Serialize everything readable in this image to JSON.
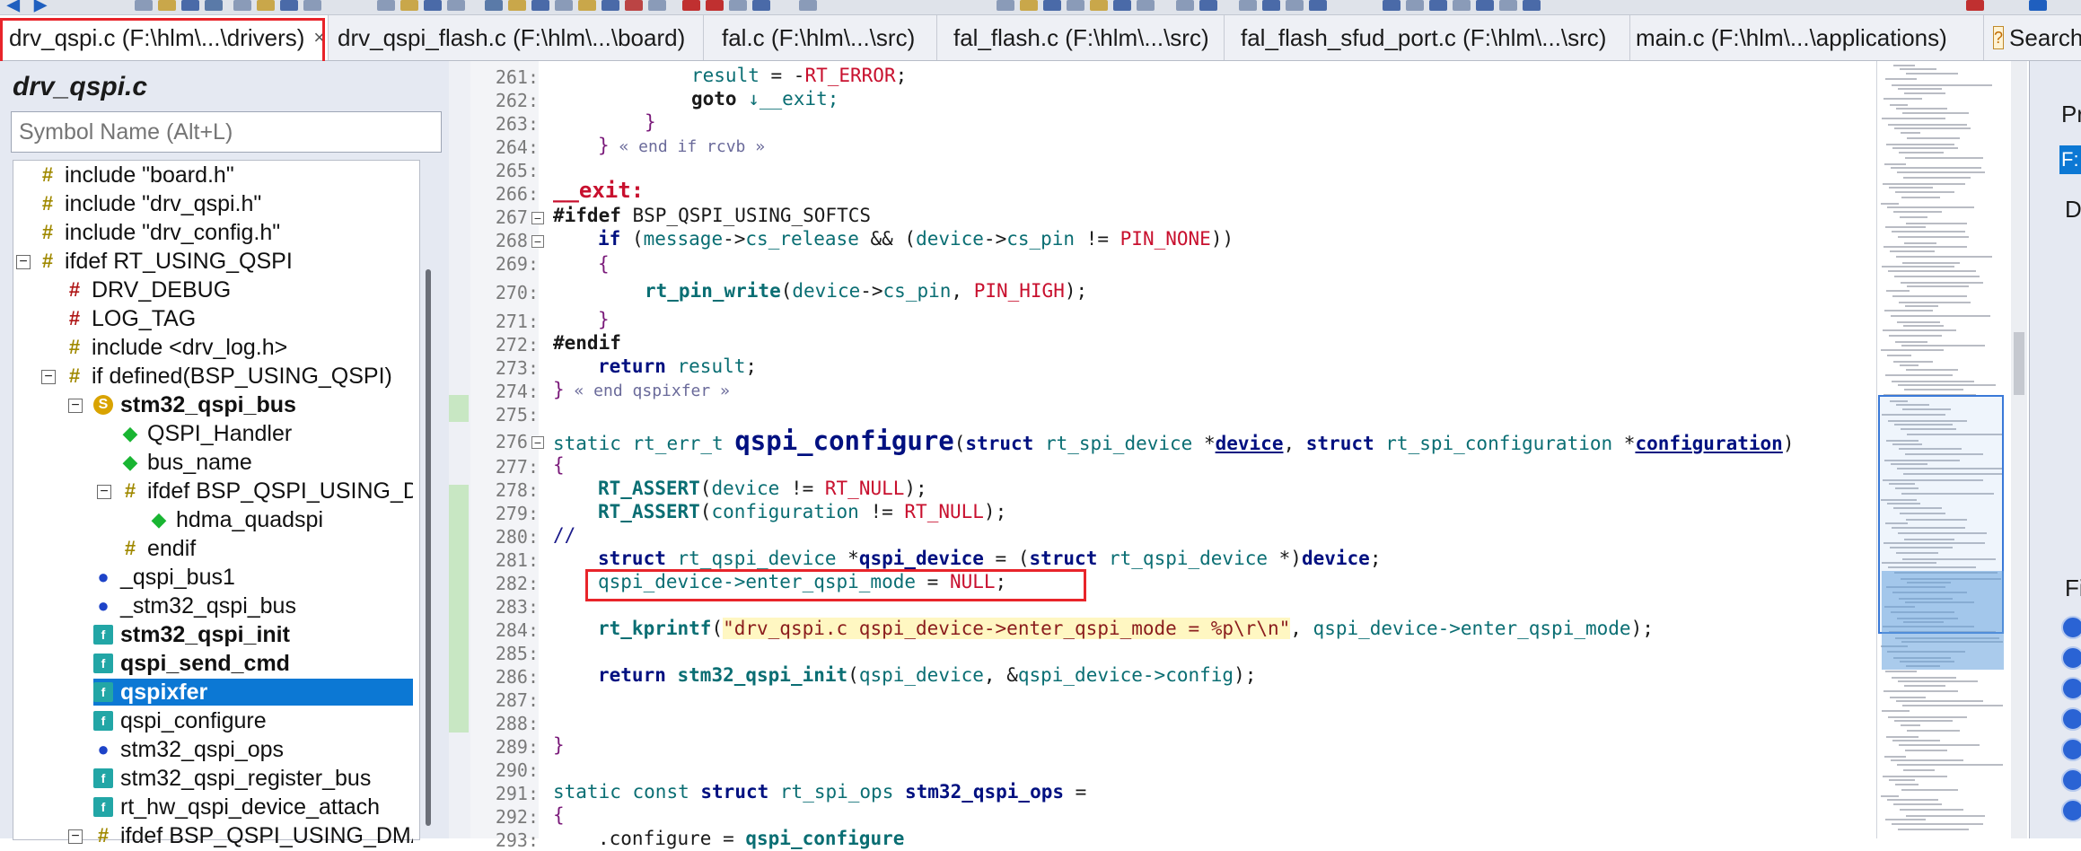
{
  "tabs": [
    {
      "label": "drv_qspi.c (F:\\hlm\\...\\drivers)",
      "close": "×",
      "active": true
    },
    {
      "label": "drv_qspi_flash.c (F:\\hlm\\...\\board)"
    },
    {
      "label": "fal.c (F:\\hlm\\...\\src)"
    },
    {
      "label": "fal_flash.c (F:\\hlm\\...\\src)"
    },
    {
      "label": "fal_flash_sfud_port.c (F:\\hlm\\...\\src)"
    },
    {
      "label": "main.c (F:\\hlm\\...\\applications)"
    },
    {
      "label": "Search"
    }
  ],
  "symbols_panel": {
    "file_title": "drv_qspi.c",
    "search_placeholder": "Symbol Name (Alt+L)",
    "items": [
      {
        "label": "include \"board.h\"",
        "icon": "hash-icon"
      },
      {
        "label": "include \"drv_qspi.h\"",
        "icon": "hash-icon"
      },
      {
        "label": "include \"drv_config.h\"",
        "icon": "hash-icon"
      },
      {
        "label": "ifdef RT_USING_QSPI",
        "icon": "hash-icon",
        "expander": "−"
      },
      {
        "label": "DRV_DEBUG",
        "icon": "red-hash-icon"
      },
      {
        "label": "LOG_TAG",
        "icon": "red-hash-icon"
      },
      {
        "label": "include <drv_log.h>",
        "icon": "hash-icon"
      },
      {
        "label": "if defined(BSP_USING_QSPI)",
        "icon": "hash-icon",
        "expander": "−"
      },
      {
        "label": "stm32_qspi_bus",
        "icon": "struct-icon",
        "expander": "−",
        "bold": true
      },
      {
        "label": "QSPI_Handler",
        "icon": "field-icon"
      },
      {
        "label": "bus_name",
        "icon": "field-icon"
      },
      {
        "label": "ifdef BSP_QSPI_USING_DMA",
        "icon": "hash-icon",
        "expander": "−"
      },
      {
        "label": "hdma_quadspi",
        "icon": "field-icon"
      },
      {
        "label": "endif",
        "icon": "hash-icon"
      },
      {
        "label": "_qspi_bus1",
        "icon": "variable-icon"
      },
      {
        "label": "_stm32_qspi_bus",
        "icon": "variable-icon"
      },
      {
        "label": "stm32_qspi_init",
        "icon": "function-icon",
        "bold": true
      },
      {
        "label": "qspi_send_cmd",
        "icon": "function-icon",
        "bold": true
      },
      {
        "label": "qspixfer",
        "icon": "function-icon",
        "bold": true,
        "selected": true
      },
      {
        "label": "qspi_configure",
        "icon": "function-icon"
      },
      {
        "label": "stm32_qspi_ops",
        "icon": "variable-icon"
      },
      {
        "label": "stm32_qspi_register_bus",
        "icon": "function-icon"
      },
      {
        "label": "rt_hw_qspi_device_attach",
        "icon": "function-icon"
      },
      {
        "label": "ifdef BSP_QSPI_USING_DMA",
        "icon": "hash-icon",
        "expander": "−"
      }
    ]
  },
  "editor": {
    "line_numbers": [
      "261:",
      "262:",
      "263:",
      "264:",
      "265:",
      "266:",
      "267:",
      "268:",
      "269:",
      "270:",
      "271:",
      "272:",
      "273:",
      "274:",
      "275:",
      "276:",
      "277:",
      "278:",
      "279:",
      "280:",
      "281:",
      "282:",
      "283:",
      "284:",
      "285:",
      "286:",
      "287:",
      "288:",
      "289:",
      "290:",
      "291:",
      "292:",
      "293:"
    ],
    "code": {
      "l261_a": "result",
      "l261_b": " = -",
      "l261_c": "RT_ERROR",
      "l261_d": ";",
      "l262_a": "goto",
      "l262_b": " ↓__exit;",
      "l263": "}",
      "l264_a": "}",
      "l264_b": " « end if rcvb »",
      "l266": "__exit:",
      "l267_a": "#ifdef",
      "l267_b": " BSP_QSPI_USING_SOFTCS",
      "l268_a": "if",
      "l268_b": " (",
      "l268_c": "message",
      "l268_d": "->",
      "l268_e": "cs_release",
      "l268_f": " && (",
      "l268_g": "device",
      "l268_h": "->",
      "l268_i": "cs_pin",
      "l268_j": " != ",
      "l268_k": "PIN_NONE",
      "l268_l": "))",
      "l269": "{",
      "l270_a": "rt_pin_write",
      "l270_b": "(",
      "l270_c": "device",
      "l270_d": "->",
      "l270_e": "cs_pin",
      "l270_f": ", ",
      "l270_g": "PIN_HIGH",
      "l270_h": ");",
      "l271": "}",
      "l272": "#endif",
      "l273_a": "return",
      "l273_b": " ",
      "l273_c": "result",
      "l273_d": ";",
      "l274_a": "}",
      "l274_b": " « end qspixfer »",
      "l276_a": "static",
      "l276_b": " ",
      "l276_c": "rt_err_t",
      "l276_d": " ",
      "l276_e": "qspi_configure",
      "l276_f": "(",
      "l276_g": "struct",
      "l276_h": " ",
      "l276_i": "rt_spi_device",
      "l276_j": " *",
      "l276_k": "device",
      "l276_l": ", ",
      "l276_m": "struct",
      "l276_n": " ",
      "l276_o": "rt_spi_configuration",
      "l276_p": " *",
      "l276_q": "configuration",
      "l276_r": ")",
      "l277": "{",
      "l278_a": "RT_ASSERT",
      "l278_b": "(",
      "l278_c": "device",
      "l278_d": " != ",
      "l278_e": "RT_NULL",
      "l278_f": ");",
      "l279_a": "RT_ASSERT",
      "l279_b": "(",
      "l279_c": "configuration",
      "l279_d": " != ",
      "l279_e": "RT_NULL",
      "l279_f": ");",
      "l280": "//",
      "l281_a": "struct",
      "l281_b": " ",
      "l281_c": "rt_qspi_device",
      "l281_d": " *",
      "l281_e": "qspi_device",
      "l281_f": " = (",
      "l281_g": "struct",
      "l281_h": " ",
      "l281_i": "rt_qspi_device",
      "l281_j": " *)",
      "l281_k": "device",
      "l281_l": ";",
      "l282_a": "qspi_device->enter_qspi_mode",
      "l282_b": " = ",
      "l282_c": "NULL",
      "l282_d": ";",
      "l284_a": "rt_kprintf",
      "l284_b": "(",
      "l284_c": "\"drv_qspi.c qspi_device->enter_qspi_mode = %p\\r\\n\"",
      "l284_d": ", ",
      "l284_e": "qspi_device->enter_qspi_mode",
      "l284_f": ");",
      "l286_a": "return",
      "l286_b": " ",
      "l286_c": "stm32_qspi_init",
      "l286_d": "(",
      "l286_e": "qspi_device",
      "l286_f": ", &",
      "l286_g": "qspi_device->config",
      "l286_h": ");",
      "l289": "}",
      "l291_a": "static",
      "l291_b": " ",
      "l291_c": "const",
      "l291_d": " ",
      "l291_e": "struct",
      "l291_f": " ",
      "l291_g": "rt_spi_ops",
      "l291_h": " ",
      "l291_i": "stm32_qspi_ops",
      "l291_j": " =",
      "l292": "{",
      "l293_a": ".configure = ",
      "l293_b": "qspi_configure"
    },
    "fold_markers": [
      "−",
      "−",
      "−"
    ]
  },
  "right_panel": {
    "label_top": "Pr",
    "label_mid": "D",
    "label_low": "Fi",
    "field": "F:"
  },
  "colors": {
    "selection": "#0c78d4",
    "annotation_red": "#e8242a",
    "editor_bg": "#ffffff",
    "panel_bg": "#e5e9f2"
  }
}
